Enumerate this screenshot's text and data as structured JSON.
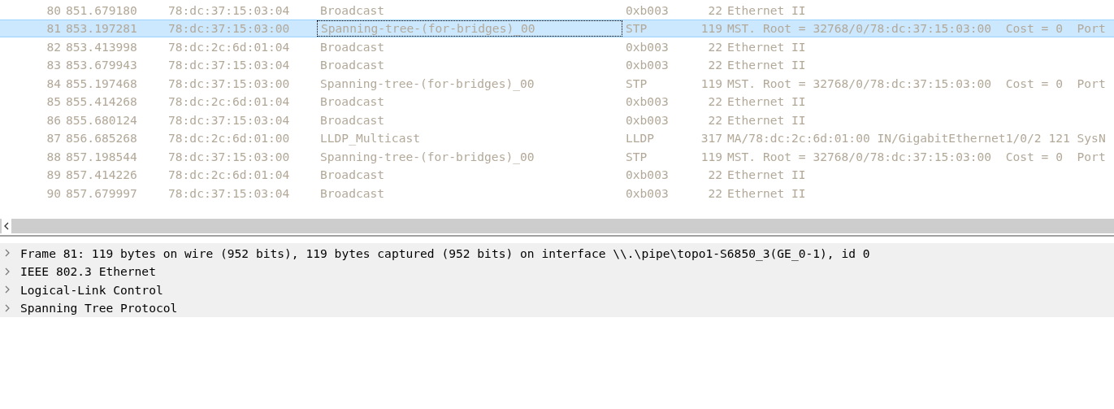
{
  "packets": [
    {
      "selected": false,
      "cells": [
        "80",
        "851.679180",
        "78:dc:37:15:03:04",
        "Broadcast",
        "0xb003",
        "22",
        "Ethernet II"
      ]
    },
    {
      "selected": true,
      "cells": [
        "81",
        "853.197281",
        "78:dc:37:15:03:00",
        "Spanning-tree-(for-bridges)_00",
        "STP",
        "119",
        "MST. Root = 32768/0/78:dc:37:15:03:00  Cost = 0  Port"
      ]
    },
    {
      "selected": false,
      "cells": [
        "82",
        "853.413998",
        "78:dc:2c:6d:01:04",
        "Broadcast",
        "0xb003",
        "22",
        "Ethernet II"
      ]
    },
    {
      "selected": false,
      "cells": [
        "83",
        "853.679943",
        "78:dc:37:15:03:04",
        "Broadcast",
        "0xb003",
        "22",
        "Ethernet II"
      ]
    },
    {
      "selected": false,
      "cells": [
        "84",
        "855.197468",
        "78:dc:37:15:03:00",
        "Spanning-tree-(for-bridges)_00",
        "STP",
        "119",
        "MST. Root = 32768/0/78:dc:37:15:03:00  Cost = 0  Port"
      ]
    },
    {
      "selected": false,
      "cells": [
        "85",
        "855.414268",
        "78:dc:2c:6d:01:04",
        "Broadcast",
        "0xb003",
        "22",
        "Ethernet II"
      ]
    },
    {
      "selected": false,
      "cells": [
        "86",
        "855.680124",
        "78:dc:37:15:03:04",
        "Broadcast",
        "0xb003",
        "22",
        "Ethernet II"
      ]
    },
    {
      "selected": false,
      "cells": [
        "87",
        "856.685268",
        "78:dc:2c:6d:01:00",
        "LLDP_Multicast",
        "LLDP",
        "317",
        "MA/78:dc:2c:6d:01:00 IN/GigabitEthernet1/0/2 121 SysN"
      ]
    },
    {
      "selected": false,
      "cells": [
        "88",
        "857.198544",
        "78:dc:37:15:03:00",
        "Spanning-tree-(for-bridges)_00",
        "STP",
        "119",
        "MST. Root = 32768/0/78:dc:37:15:03:00  Cost = 0  Port"
      ]
    },
    {
      "selected": false,
      "cells": [
        "89",
        "857.414226",
        "78:dc:2c:6d:01:04",
        "Broadcast",
        "0xb003",
        "22",
        "Ethernet II"
      ]
    },
    {
      "selected": false,
      "cells": [
        "90",
        "857.679997",
        "78:dc:37:15:03:04",
        "Broadcast",
        "0xb003",
        "22",
        "Ethernet II"
      ]
    }
  ],
  "details": [
    {
      "label": "Frame 81: 119 bytes on wire (952 bits), 119 bytes captured (952 bits) on interface \\\\.\\pipe\\topo1-S6850_3(GE_0-1), id 0",
      "expanded": false
    },
    {
      "label": "IEEE 802.3 Ethernet",
      "expanded": false
    },
    {
      "label": "Logical-Link Control",
      "expanded": false
    },
    {
      "label": "Spanning Tree Protocol",
      "expanded": false
    }
  ]
}
